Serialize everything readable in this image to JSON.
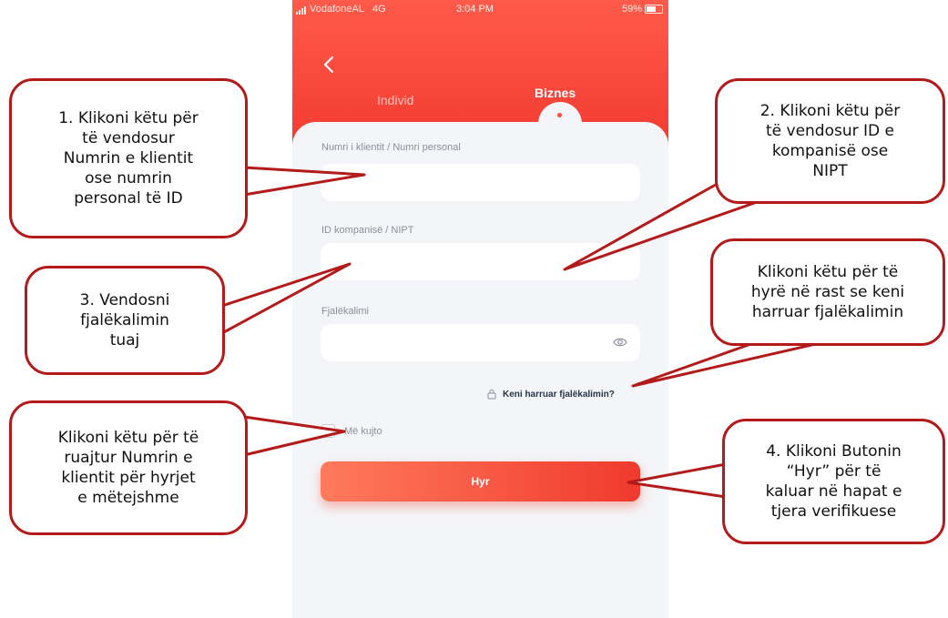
{
  "status_bar": {
    "carrier": "VodafoneAL",
    "network": "4G",
    "time": "3:04 PM",
    "battery": "59%"
  },
  "header": {
    "back_icon": "chevron-left-icon",
    "tabs": [
      {
        "label": "Individ",
        "active": false
      },
      {
        "label": "Biznes",
        "active": true
      }
    ]
  },
  "form": {
    "client_number_label": "Numri i klientit / Numri personal",
    "client_number_value": "",
    "company_id_label": "ID kompanisë / NIPT",
    "company_id_value": "",
    "password_label": "Fjalëkalimi",
    "password_value": "",
    "password_toggle_icon": "eye-icon",
    "forgot_link": "Keni harruar fjalëkalimin?",
    "forgot_icon": "lock-icon",
    "remember_label": "Më kujto",
    "remember_checked": false,
    "login_button": "Hyr"
  },
  "callouts": {
    "client_number": "1. Klikoni këtu për\ntë vendosur\nNumrin e klientit\nose numrin\npersonal të ID",
    "company_id": "2. Klikoni këtu për\ntë vendosur ID e\nkompanisë ose\nNIPT",
    "password": "3. Vendosni\nfjalëkalimin\ntuaj",
    "forgot": "Klikoni këtu për të\nhyrë në rast se keni\nharruar fjalëkalimin",
    "remember": "Klikoni këtu për të\nruajtur Numrin e\nklientit për hyrjet\ne mëtejshme",
    "login": "4. Klikoni Butonin\n“Hyr” për të\nkaluar në hapat e\ntjera verifikuese"
  },
  "colors": {
    "brand_red": "#f0352d",
    "callout_border": "#b31b1b",
    "screen_bg": "#f1f2f6"
  }
}
